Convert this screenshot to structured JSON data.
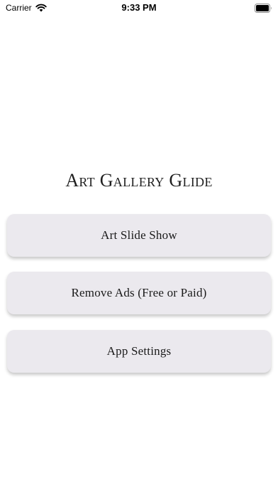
{
  "status_bar": {
    "carrier": "Carrier",
    "time": "9:33 PM"
  },
  "app": {
    "title": "Art Gallery Glide"
  },
  "menu": {
    "buttons": [
      {
        "label": "Art Slide Show"
      },
      {
        "label": "Remove Ads (Free or Paid)"
      },
      {
        "label": "App Settings"
      }
    ]
  },
  "colors": {
    "background": "#ffffff",
    "button_background": "#ebe9ee",
    "text": "#1a1a1a"
  },
  "icons": [
    "wifi-icon",
    "battery-icon"
  ]
}
